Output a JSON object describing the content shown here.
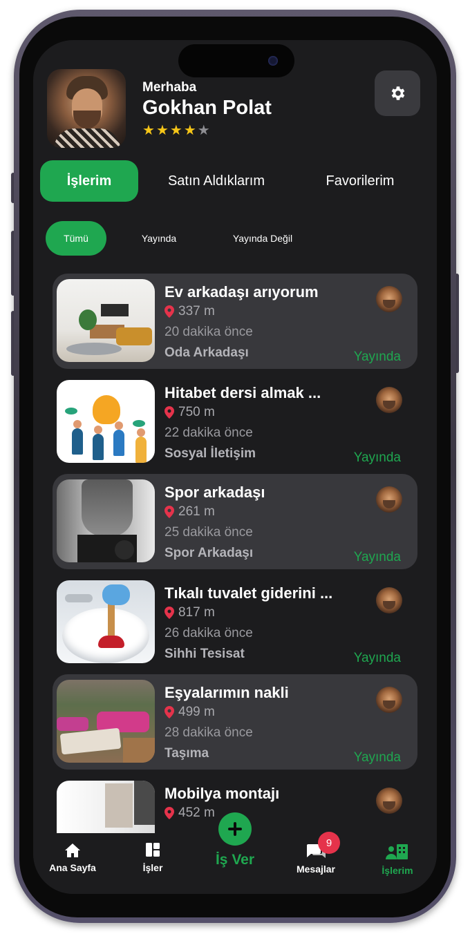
{
  "header": {
    "greeting": "Merhaba",
    "user_name": "Gokhan Polat",
    "rating": 4,
    "rating_max": 5
  },
  "main_tabs": [
    {
      "label": "İşlerim",
      "active": true
    },
    {
      "label": "Satın Aldıklarım",
      "active": false
    },
    {
      "label": "Favorilerim",
      "active": false
    }
  ],
  "filter_chips": [
    {
      "label": "Tümü",
      "active": true
    },
    {
      "label": "Yayında",
      "active": false
    },
    {
      "label": "Yayında Değil",
      "active": false
    }
  ],
  "listings": [
    {
      "title": "Ev arkadaşı arıyorum",
      "distance": "337 m",
      "time": "20 dakika önce",
      "category": "Oda Arkadaşı",
      "status": "Yayında"
    },
    {
      "title": "Hitabet dersi almak ...",
      "distance": "750 m",
      "time": "22 dakika önce",
      "category": "Sosyal İletişim",
      "status": "Yayında"
    },
    {
      "title": "Spor arkadaşı",
      "distance": "261 m",
      "time": "25 dakika önce",
      "category": "Spor Arkadaşı",
      "status": "Yayında"
    },
    {
      "title": "Tıkalı tuvalet giderini ...",
      "distance": "817 m",
      "time": "26 dakika önce",
      "category": "Sihhi Tesisat",
      "status": "Yayında"
    },
    {
      "title": "Eşyalarımın nakli",
      "distance": "499 m",
      "time": "28 dakika önce",
      "category": "Taşıma",
      "status": "Yayında"
    },
    {
      "title": "Mobilya montajı",
      "distance": "452 m",
      "time": "",
      "category": "",
      "status": ""
    }
  ],
  "bottom_nav": {
    "home": "Ana Sayfa",
    "jobs": "İşler",
    "post_job": "İş Ver",
    "messages": "Mesajlar",
    "messages_badge": "9",
    "my_jobs": "İşlerim"
  },
  "colors": {
    "accent": "#1fa750",
    "background": "#1c1c1e",
    "card": "#38383c",
    "star": "#f5c518",
    "pin": "#e5334b",
    "badge": "#e5334b"
  }
}
